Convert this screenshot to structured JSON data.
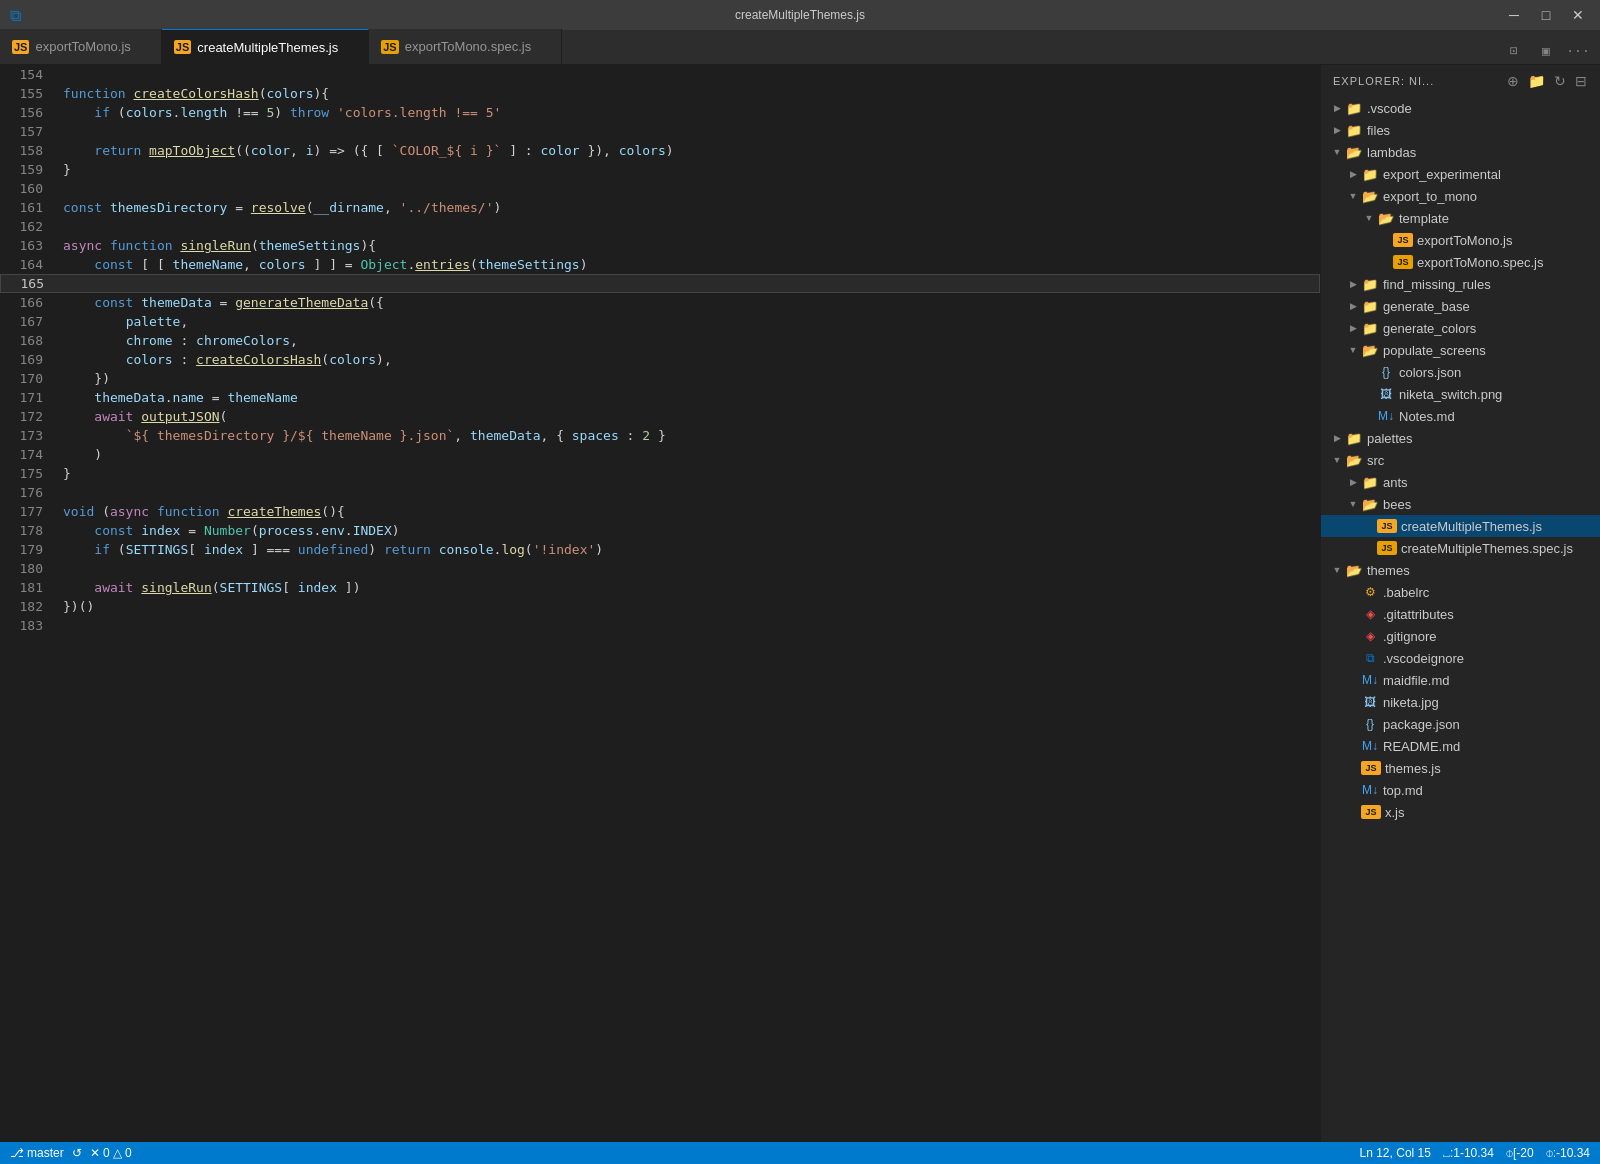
{
  "titlebar": {
    "title": "createMultipleThemes.js",
    "minimize": "─",
    "maximize": "□",
    "close": "✕"
  },
  "tabs": [
    {
      "id": "tab1",
      "label": "exportToMono.js",
      "icon": "JS",
      "active": false,
      "modified": false
    },
    {
      "id": "tab2",
      "label": "createMultipleThemes.js",
      "icon": "JS",
      "active": true,
      "modified": false
    },
    {
      "id": "tab3",
      "label": "exportToMono.spec.js",
      "icon": "JS",
      "active": false,
      "modified": false
    }
  ],
  "sidebar": {
    "header": "EXPLORER: NI...",
    "tree": [
      {
        "id": "vscode",
        "indent": 0,
        "arrow": "▶",
        "icon": "📁",
        "iconClass": "icon-folder",
        "label": ".vscode",
        "type": "folder"
      },
      {
        "id": "files",
        "indent": 0,
        "arrow": "▶",
        "icon": "📁",
        "iconClass": "icon-folder",
        "label": "files",
        "type": "folder"
      },
      {
        "id": "lambdas",
        "indent": 0,
        "arrow": "▼",
        "icon": "📂",
        "iconClass": "icon-folder-open",
        "label": "lambdas",
        "type": "folder-open"
      },
      {
        "id": "export_experimental",
        "indent": 1,
        "arrow": "▶",
        "icon": "📁",
        "iconClass": "icon-folder",
        "label": "export_experimental",
        "type": "folder"
      },
      {
        "id": "export_to_mono",
        "indent": 1,
        "arrow": "▼",
        "icon": "📂",
        "iconClass": "icon-folder-open",
        "label": "export_to_mono",
        "type": "folder-open"
      },
      {
        "id": "template",
        "indent": 2,
        "arrow": "▼",
        "icon": "📂",
        "iconClass": "icon-folder-open",
        "label": "template",
        "type": "folder-open"
      },
      {
        "id": "exportToMono_js",
        "indent": 3,
        "arrow": "",
        "icon": "⬡",
        "iconClass": "icon-js",
        "label": "exportToMono.js",
        "type": "file"
      },
      {
        "id": "exportToMono_spec",
        "indent": 3,
        "arrow": "",
        "icon": "⬡",
        "iconClass": "icon-spec",
        "label": "exportToMono.spec.js",
        "type": "file"
      },
      {
        "id": "find_missing_rules",
        "indent": 1,
        "arrow": "▶",
        "icon": "📁",
        "iconClass": "icon-folder",
        "label": "find_missing_rules",
        "type": "folder"
      },
      {
        "id": "generate_base",
        "indent": 1,
        "arrow": "▶",
        "icon": "📁",
        "iconClass": "icon-folder",
        "label": "generate_base",
        "type": "folder"
      },
      {
        "id": "generate_colors",
        "indent": 1,
        "arrow": "▶",
        "icon": "📁",
        "iconClass": "icon-folder",
        "label": "generate_colors",
        "type": "folder"
      },
      {
        "id": "populate_screens",
        "indent": 1,
        "arrow": "▼",
        "icon": "📂",
        "iconClass": "icon-folder-open",
        "label": "populate_screens",
        "type": "folder-open"
      },
      {
        "id": "colors_json",
        "indent": 2,
        "arrow": "",
        "icon": "⬡",
        "iconClass": "icon-json",
        "label": "colors.json",
        "type": "file"
      },
      {
        "id": "niketa_switch_png",
        "indent": 2,
        "arrow": "",
        "icon": "⬡",
        "iconClass": "icon-png",
        "label": "niketa_switch.png",
        "type": "file"
      },
      {
        "id": "notes_md",
        "indent": 2,
        "arrow": "",
        "icon": "⬡",
        "iconClass": "icon-md",
        "label": "Notes.md",
        "type": "file"
      },
      {
        "id": "palettes",
        "indent": 0,
        "arrow": "▶",
        "icon": "📁",
        "iconClass": "icon-folder",
        "label": "palettes",
        "type": "folder"
      },
      {
        "id": "src",
        "indent": 0,
        "arrow": "▼",
        "icon": "📂",
        "iconClass": "icon-folder-open",
        "label": "src",
        "type": "folder-open"
      },
      {
        "id": "ants",
        "indent": 1,
        "arrow": "▶",
        "icon": "📁",
        "iconClass": "icon-folder",
        "label": "ants",
        "type": "folder"
      },
      {
        "id": "bees",
        "indent": 1,
        "arrow": "▼",
        "icon": "📂",
        "iconClass": "icon-folder-open",
        "label": "bees",
        "type": "folder-open"
      },
      {
        "id": "createMultipleThemes_js",
        "indent": 2,
        "arrow": "",
        "icon": "⬡",
        "iconClass": "icon-js",
        "label": "createMultipleThemes.js",
        "type": "file",
        "selected": true
      },
      {
        "id": "createMultipleThemes_spec",
        "indent": 2,
        "arrow": "",
        "icon": "⬡",
        "iconClass": "icon-spec",
        "label": "createMultipleThemes.spec.js",
        "type": "file"
      },
      {
        "id": "themes",
        "indent": 0,
        "arrow": "▼",
        "icon": "📂",
        "iconClass": "icon-folder-open",
        "label": "themes",
        "type": "folder-open"
      },
      {
        "id": "babelrc",
        "indent": 1,
        "arrow": "",
        "icon": "⬡",
        "iconClass": "icon-babelrc",
        "label": ".babelrc",
        "type": "file"
      },
      {
        "id": "gitattributes",
        "indent": 1,
        "arrow": "",
        "icon": "⬡",
        "iconClass": "icon-gitignore",
        "label": ".gitattributes",
        "type": "file"
      },
      {
        "id": "gitignore",
        "indent": 1,
        "arrow": "",
        "icon": "⬡",
        "iconClass": "icon-gitignore",
        "label": ".gitignore",
        "type": "file"
      },
      {
        "id": "vscodeignore",
        "indent": 1,
        "arrow": "",
        "icon": "⬡",
        "iconClass": "icon-vscode",
        "label": ".vscodeignore",
        "type": "file"
      },
      {
        "id": "maidfile_md",
        "indent": 1,
        "arrow": "",
        "icon": "⬡",
        "iconClass": "icon-maidfile",
        "label": "maidfile.md",
        "type": "file"
      },
      {
        "id": "niketa_jpg",
        "indent": 1,
        "arrow": "",
        "icon": "⬡",
        "iconClass": "icon-jpg",
        "label": "niketa.jpg",
        "type": "file"
      },
      {
        "id": "package_json",
        "indent": 1,
        "arrow": "",
        "icon": "⬡",
        "iconClass": "icon-json",
        "label": "package.json",
        "type": "file"
      },
      {
        "id": "readme_md",
        "indent": 1,
        "arrow": "",
        "icon": "⬡",
        "iconClass": "icon-md",
        "label": "README.md",
        "type": "file"
      },
      {
        "id": "themes_js",
        "indent": 1,
        "arrow": "",
        "icon": "⬡",
        "iconClass": "icon-js",
        "label": "themes.js",
        "type": "file"
      },
      {
        "id": "top_md",
        "indent": 1,
        "arrow": "",
        "icon": "⬡",
        "iconClass": "icon-md",
        "label": "top.md",
        "type": "file"
      },
      {
        "id": "x_js",
        "indent": 1,
        "arrow": "",
        "icon": "⬡",
        "iconClass": "icon-js",
        "label": "x.js",
        "type": "file"
      }
    ]
  },
  "statusbar": {
    "branch": "master",
    "sync": "↺",
    "errors": "✕ 0",
    "warnings": "△ 0",
    "position": "Ln 12, Col 15",
    "indent": "⎵:1-10.34",
    "encoding": "⌽[-20",
    "eol": "⌽:-10.34"
  },
  "code_lines": [
    {
      "num": 154,
      "content": ""
    },
    {
      "num": 155,
      "content": ""
    },
    {
      "num": 156,
      "content": ""
    },
    {
      "num": 157,
      "content": ""
    },
    {
      "num": 158,
      "content": ""
    },
    {
      "num": 159,
      "content": ""
    },
    {
      "num": 160,
      "content": ""
    },
    {
      "num": 161,
      "content": ""
    },
    {
      "num": 162,
      "content": ""
    },
    {
      "num": 163,
      "content": ""
    },
    {
      "num": 164,
      "content": ""
    },
    {
      "num": 165,
      "content": ""
    },
    {
      "num": 166,
      "content": ""
    },
    {
      "num": 167,
      "content": ""
    },
    {
      "num": 168,
      "content": ""
    },
    {
      "num": 169,
      "content": ""
    },
    {
      "num": 170,
      "content": ""
    },
    {
      "num": 171,
      "content": ""
    },
    {
      "num": 172,
      "content": ""
    },
    {
      "num": 173,
      "content": ""
    },
    {
      "num": 174,
      "content": ""
    },
    {
      "num": 175,
      "content": ""
    },
    {
      "num": 176,
      "content": ""
    },
    {
      "num": 177,
      "content": ""
    },
    {
      "num": 178,
      "content": ""
    },
    {
      "num": 179,
      "content": ""
    },
    {
      "num": 180,
      "content": ""
    },
    {
      "num": 181,
      "content": ""
    },
    {
      "num": 182,
      "content": ""
    }
  ]
}
